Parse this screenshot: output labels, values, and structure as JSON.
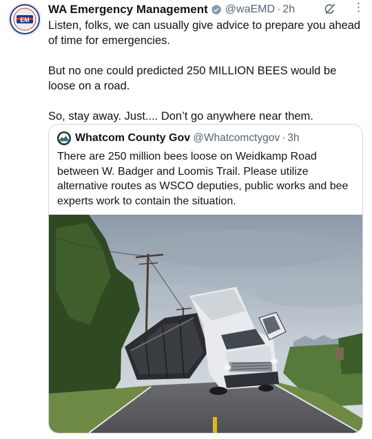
{
  "tweet": {
    "author_name": "WA Emergency Management",
    "handle": "@waEMD",
    "separator": "·",
    "time": "2h",
    "paragraphs": [
      "Listen, folks, we can usually give advice to prepare you ahead of time for emergencies.",
      "But no one could predicted 250 MILLION BEES would be loose on a road.",
      "So, stay away. Just.... Don’t go anywhere near them."
    ],
    "more_icon": "⋮"
  },
  "quoted": {
    "author_name": "Whatcom County Gov",
    "handle": "@Whatcomctygov",
    "separator": "·",
    "time": "3h",
    "text": "There are 250 million bees loose on Weidkamp Road between W. Badger and Loomis Trail. Please utilize alternative routes as WSCO deputies, public works and bee experts work to contain the situation."
  },
  "icons": {
    "verified": "verified-badge-icon",
    "grok": "grok-icon",
    "more": "more-options-icon"
  },
  "colors": {
    "verified_badge": "#829aab",
    "secondary_text": "#536471",
    "border": "#cfd9de"
  }
}
